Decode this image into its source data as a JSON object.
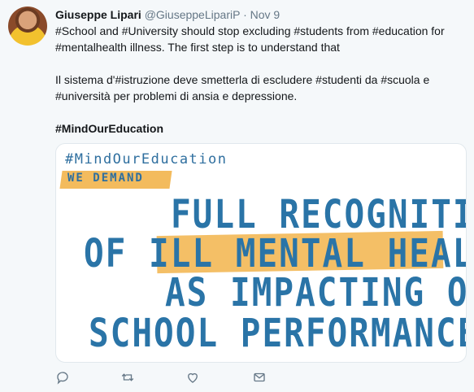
{
  "tweet": {
    "author_name": "Giuseppe Lipari",
    "author_handle": "@GiuseppeLipariP",
    "separator": "·",
    "date": "Nov 9",
    "line1": "#School and #University should stop excluding #students from #education for",
    "line2": "#mentalhealth illness. The first step is to understand that",
    "line3": "Il sistema d'#istruzione deve smetterla di escludere #studenti da #scuola e",
    "line4": "#università per problemi di ansia e depressione.",
    "line5": "#MindOurEducation"
  },
  "card": {
    "hashtag": "#MindOurEducation",
    "we_demand": "WE DEMAND",
    "line1": "FULL RECOGNITION",
    "line2": "OF ILL MENTAL HEALTH",
    "line3": "AS IMPACTING ON",
    "line4": "SCHOOL PERFORMANCE"
  },
  "actions": {
    "icons": [
      "reply-icon",
      "retweet-icon",
      "like-icon",
      "message-icon"
    ]
  },
  "colors": {
    "accent": "#2a74a7",
    "highlight": "#f2b44b",
    "muted": "#657786"
  }
}
